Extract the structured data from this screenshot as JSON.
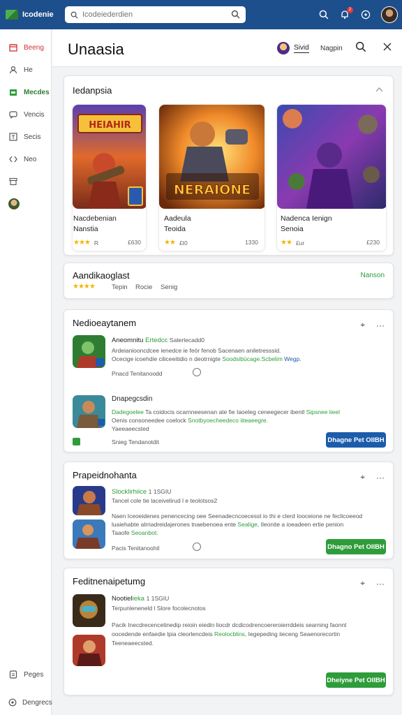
{
  "topbar": {
    "logo_text": "Icodenie",
    "search_placeholder": "Icodeiederdien",
    "notification_count": "2"
  },
  "sidebar": {
    "items": [
      {
        "label": "Beeng",
        "icon": "calendar-icon"
      },
      {
        "label": "He",
        "icon": "user-icon"
      },
      {
        "label": "Mecdes",
        "icon": "store-icon"
      },
      {
        "label": "Vencis",
        "icon": "chat-icon"
      },
      {
        "label": "Secis",
        "icon": "text-icon"
      },
      {
        "label": "Neo",
        "icon": "code-icon"
      },
      {
        "label": "",
        "icon": "archive-icon"
      },
      {
        "label": "",
        "icon": "avatar"
      }
    ],
    "bottom": [
      {
        "label": "Peges",
        "icon": "page-icon"
      },
      {
        "label": "Dengrecs",
        "icon": "settings-icon"
      }
    ]
  },
  "header": {
    "title": "Unaasia",
    "user": "Sivid",
    "link": "Nagpin"
  },
  "featured": {
    "title": "Iedanpsia",
    "tiles": [
      {
        "name1": "Nacdebenian",
        "name2": "Nanstia",
        "num": "£630",
        "rating": "R",
        "art_title": "HEIAHIR"
      },
      {
        "name1": "Aadeula",
        "name2": "Teoida",
        "num": "1330",
        "rating": "£t0",
        "art_title": "NERAIONE"
      },
      {
        "name1": "Nadenca Ienign",
        "name2": "Senoia",
        "num": "£230",
        "rating": "£ur",
        "art_title": ""
      }
    ]
  },
  "filters": {
    "title": "Aandikaoglast",
    "tags": [
      "Tepin",
      "Rocie",
      "Senig"
    ],
    "link": "Nanson"
  },
  "section1": {
    "title": "Nedioeaytanem",
    "rows": [
      {
        "head": "Aneomnitu",
        "sub": "Saterlecadd0",
        "line1": "Ardeianiooncdcee ienedce ie feör fenob Sacenaen aniletresssid.",
        "line2_a": "Ocecige icoehdie ciliceeitidio n deotrnigte",
        "line2_g": "Soodsibücage.Scbelim",
        "line2_b": "Wegp.",
        "meta": "Pnacd Tenitanoodd",
        "head_green": "Ertedcc"
      },
      {
        "head": "Dnapegcsdin",
        "line1_a": "Dadegoelee",
        "line1_b": "Ta coidocis ocarnneesenan ate fie Iaoeleg ceneegecer ibentl",
        "line1_g": "Sipsnee iieel",
        "line2_a": "Oenis consoneedee coelock",
        "line2_g": "Snotbyoecheedeco iiteaeegre.",
        "line3": "Yaeeaeecsted",
        "meta": "Snieg Tendanotdit",
        "button": "Dhagne Pet OIIBH"
      }
    ]
  },
  "section2": {
    "title": "Prapeidnohanta",
    "head": "Slocklirhiice",
    "head_meta": "1 1SGIU",
    "sub": "Tancel cole tie laceivelirud l e teolotsos2",
    "line1": "Naen Iceoeidenes penencecing oee Seenadecncoecesst io thi e clerd Iooceione ne feclicoeeod",
    "line2_a": "luaiehabte alrriadreidajerones tnaebenoea ente",
    "line2_g": "Sealige,",
    "line2_b": "Ileonite a ioeadeen ertie penion",
    "line3_a": "Taaofe",
    "line3_g": "Seoanbot.",
    "meta": "Pacis Tenitanoohil",
    "button": "Dhagno Pet OIIBH"
  },
  "section3": {
    "title": "Feditnenaipetumg",
    "head": "Nootiel",
    "head_green": "ieka",
    "head_meta": "1 1SGIU",
    "sub": "Terpunleneneld l Slore focolecnotos",
    "line1": "Pacik Inecdrecencetinedip reioin eiedin liocdr dcdicodrencoereroierrddeis searning faonnt",
    "line2_a": "oocedende enfaedie lpia cleorlencdeis",
    "line2_g": "Reolocblins,",
    "line2_b": "Iegepeding iieceng Seaenorecortin",
    "line3": "Teeneaeecsted.",
    "button": "Dheiyne Pet OIIBH"
  },
  "colors": {
    "topbar": "#1d4f8c",
    "accent_green": "#2e9c3a",
    "accent_blue": "#1d5cab",
    "alert_red": "#d32f2f",
    "star": "#f4b400"
  }
}
